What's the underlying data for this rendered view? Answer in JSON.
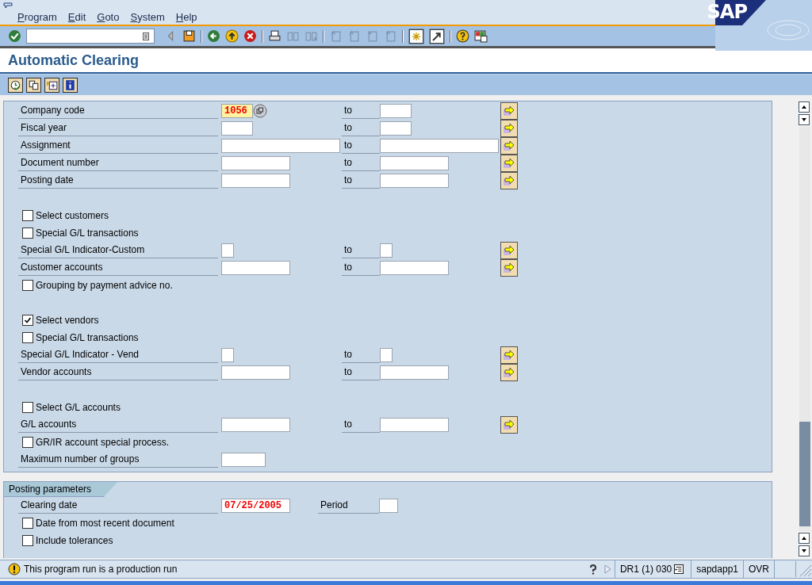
{
  "menu": [
    "Program",
    "Edit",
    "Goto",
    "System",
    "Help"
  ],
  "logo": "SAP",
  "title": "Automatic Clearing",
  "selection": {
    "rows": [
      {
        "kind": "range",
        "label": "Company code",
        "value": "1056",
        "required": true,
        "to_label": "to"
      },
      {
        "kind": "range",
        "label": "Fiscal year",
        "required": false,
        "to_label": "to"
      },
      {
        "kind": "range",
        "label": "Assignment",
        "required": false,
        "to_label": "to"
      },
      {
        "kind": "range",
        "label": "Document number",
        "required": false,
        "to_label": "to"
      },
      {
        "kind": "range",
        "label": "Posting date",
        "required": false,
        "to_label": "to"
      },
      {
        "kind": "gap"
      },
      {
        "kind": "check",
        "label": "Select customers",
        "checked": false
      },
      {
        "kind": "check",
        "label": "Special G/L transactions",
        "checked": false
      },
      {
        "kind": "range",
        "label": "Special G/L Indicator-Custom",
        "required": false,
        "to_label": "to"
      },
      {
        "kind": "range",
        "label": "Customer accounts",
        "required": false,
        "to_label": "to"
      },
      {
        "kind": "check",
        "label": "Grouping by payment advice no.",
        "checked": false
      },
      {
        "kind": "gap"
      },
      {
        "kind": "check",
        "label": "Select vendors",
        "checked": true
      },
      {
        "kind": "check",
        "label": "Special G/L transactions",
        "checked": false
      },
      {
        "kind": "range",
        "label": "Special G/L Indicator - Vend",
        "required": false,
        "to_label": "to"
      },
      {
        "kind": "range",
        "label": "Vendor accounts",
        "required": false,
        "to_label": "to"
      },
      {
        "kind": "gap"
      },
      {
        "kind": "check",
        "label": "Select G/L accounts",
        "checked": false
      },
      {
        "kind": "range",
        "label": "G/L accounts",
        "required": false,
        "to_label": "to"
      },
      {
        "kind": "check",
        "label": "GR/IR account special process.",
        "checked": false
      },
      {
        "kind": "single",
        "label": "Maximum number of groups",
        "required": false
      }
    ]
  },
  "posting_parameters": {
    "title": "Posting parameters",
    "clearing_date": {
      "label": "Clearing date",
      "value": "07/25/2005"
    },
    "period": {
      "label": "Period"
    },
    "options": [
      {
        "label": "Date from most recent document",
        "checked": false
      },
      {
        "label": "Include tolerances",
        "checked": false
      }
    ]
  },
  "status_bar": {
    "message": "This program run is a production run",
    "system": "DR1 (1) 030",
    "server": "sapdapp1",
    "mode": "OVR"
  }
}
